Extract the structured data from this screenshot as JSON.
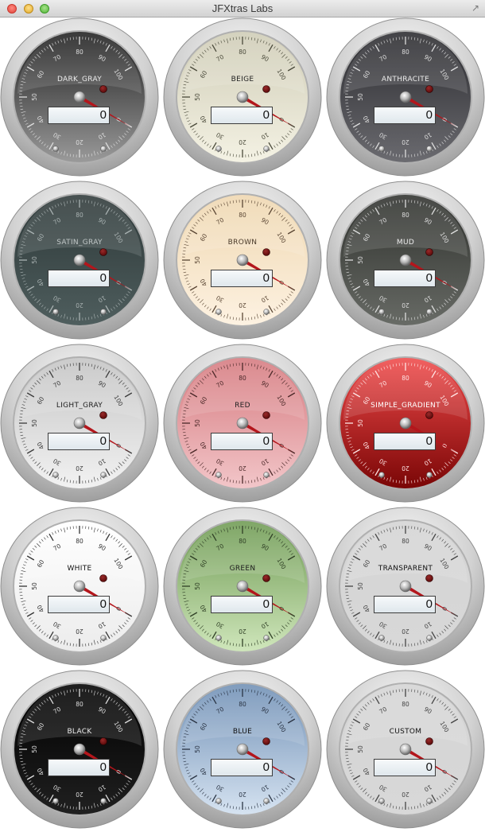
{
  "window": {
    "title": "JFXtras Labs"
  },
  "colors": {
    "needle": "#b3161c",
    "led_off": "#5a0a0a"
  },
  "gauges": [
    {
      "label": "DARK_GRAY",
      "value": "0",
      "text_color": "#ececec",
      "tick_color": "#dedede",
      "face_top": "#1e1e1e",
      "face_bottom": "#9a9a9a"
    },
    {
      "label": "BEIGE",
      "value": "0",
      "text_color": "#222222",
      "tick_color": "#4a4a3a",
      "face_top": "#cfccb6",
      "face_bottom": "#f4f2e4"
    },
    {
      "label": "ANTHRACITE",
      "value": "0",
      "text_color": "#ececec",
      "tick_color": "#dedede",
      "face_top": "#2a2a2e",
      "face_bottom": "#6b6b70"
    },
    {
      "label": "SATIN_GRAY",
      "value": "0",
      "text_color": "#c0c7c7",
      "tick_color": "#a9b2b2",
      "face_top": "#2d3838",
      "face_bottom": "#4f5e5e"
    },
    {
      "label": "BROWN",
      "value": "0",
      "text_color": "#4a3a2a",
      "tick_color": "#5a4634",
      "face_top": "#efd7b0",
      "face_bottom": "#fdf2e2"
    },
    {
      "label": "MUD",
      "value": "0",
      "text_color": "#ececec",
      "tick_color": "#dedede",
      "face_top": "#2e302c",
      "face_bottom": "#686b66"
    },
    {
      "label": "LIGHT_GRAY",
      "value": "0",
      "text_color": "#1c1c1c",
      "tick_color": "#3a3a3a",
      "face_top": "#c4c4c4",
      "face_bottom": "#f2f2f2"
    },
    {
      "label": "RED",
      "value": "0",
      "text_color": "#222222",
      "tick_color": "#4a2828",
      "face_top": "#d67a7f",
      "face_bottom": "#f2c6c9"
    },
    {
      "label": "SIMPLE_GRADIENT",
      "value": "0",
      "text_color": "#ffffff",
      "tick_color": "#ffe6e6",
      "face_top": "#f04a4a",
      "face_bottom": "#7a0606"
    },
    {
      "label": "WHITE",
      "value": "0",
      "text_color": "#111111",
      "tick_color": "#333333",
      "face_top": "#ffffff",
      "face_bottom": "#ececec"
    },
    {
      "label": "GREEN",
      "value": "0",
      "text_color": "#1c1c1c",
      "tick_color": "#2f3f25",
      "face_top": "#6e9a52",
      "face_bottom": "#cfe6bb"
    },
    {
      "label": "TRANSPARENT",
      "value": "0",
      "text_color": "#111111",
      "tick_color": "#444444",
      "face_top": "#d4d4d4",
      "face_bottom": "#d8d8d8"
    },
    {
      "label": "BLACK",
      "value": "0",
      "text_color": "#ececec",
      "tick_color": "#dedede",
      "face_top": "#000000",
      "face_bottom": "#202020"
    },
    {
      "label": "BLUE",
      "value": "0",
      "text_color": "#111111",
      "tick_color": "#2a3444",
      "face_top": "#6f8fb5",
      "face_bottom": "#d6e3f1"
    },
    {
      "label": "CUSTOM",
      "value": "0",
      "text_color": "#111111",
      "tick_color": "#444444",
      "face_top": "#d4d4d4",
      "face_bottom": "#d8d8d8"
    }
  ]
}
